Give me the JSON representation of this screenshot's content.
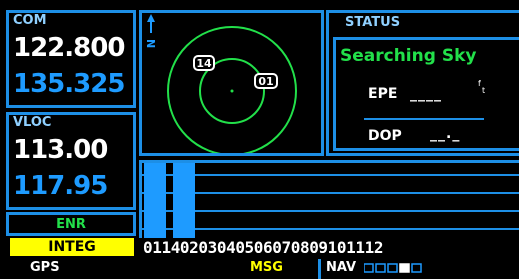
{
  "com": {
    "label": "COM",
    "active": "122.800",
    "standby": "135.325"
  },
  "vloc": {
    "label": "VLOC",
    "active": "113.00",
    "standby": "117.95"
  },
  "mode": "ENR",
  "integ": "INTEG",
  "sky": {
    "north_label": "N",
    "satellites": [
      {
        "id": "14",
        "style": "outline"
      },
      {
        "id": "01",
        "style": "filled"
      }
    ]
  },
  "status": {
    "title": "STATUS",
    "message": "Searching Sky",
    "epe_label": "EPE",
    "epe_value": "____",
    "dop_label": "DOP",
    "dop_value": "__._"
  },
  "signal": {
    "sat_numbers": "01140203040506070809101112",
    "bar_levels": [
      1,
      1,
      0,
      0,
      0,
      0,
      0,
      0,
      0,
      0,
      0,
      0,
      0
    ]
  },
  "footer": {
    "left": "GPS",
    "msg": "MSG",
    "nav": "NAV"
  },
  "colors": {
    "frame": "#1d8fe6",
    "green": "#22e04a",
    "yellow": "#ffff00",
    "cyan": "#1e9bff"
  }
}
